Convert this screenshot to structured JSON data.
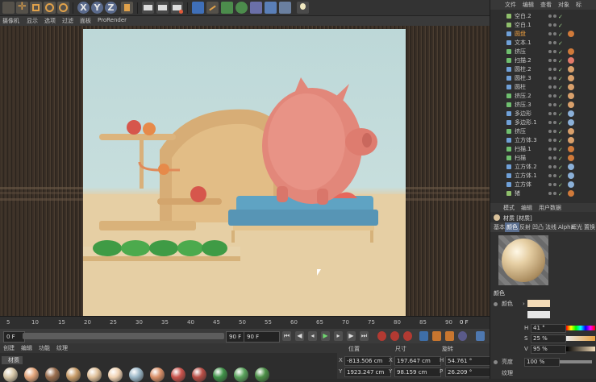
{
  "toolbar": {
    "axis_labels": [
      "X",
      "Y",
      "Z"
    ]
  },
  "viewport_menu": [
    "摄像机",
    "显示",
    "选项",
    "过滤",
    "面板",
    "ProRender"
  ],
  "timeline": {
    "ruler_ticks": [
      "5",
      "10",
      "15",
      "20",
      "25",
      "30",
      "35",
      "40",
      "45",
      "50",
      "55",
      "60",
      "65",
      "70",
      "75",
      "80",
      "85",
      "90"
    ],
    "current_frame_label": "0 F",
    "start_field": "0 F",
    "end_field": "90 F",
    "max_field": "90 F"
  },
  "material_menu": [
    "创建",
    "编辑",
    "功能",
    "纹理"
  ],
  "material_tab_label": "材质",
  "materials": [
    {
      "color": "#d7c7a8"
    },
    {
      "color": "#e3a57b"
    },
    {
      "color": "#9b6f4f"
    },
    {
      "color": "#c99d6a"
    },
    {
      "color": "#e0c09a"
    },
    {
      "color": "#f0d2b2"
    },
    {
      "color": "#9bb7c7"
    },
    {
      "color": "#d98f68"
    },
    {
      "color": "#c9524b"
    },
    {
      "color": "#b84d45"
    },
    {
      "color": "#3f9248"
    },
    {
      "color": "#5aa35c"
    },
    {
      "color": "#4b8f46"
    }
  ],
  "coordinates": {
    "headers": {
      "position": "位置",
      "size": "尺寸",
      "rotation": "旋转"
    },
    "rows": [
      {
        "axis": "X",
        "position": "-813.506 cm",
        "size_axis": "X",
        "size": "197.647 cm",
        "rot_axis": "H",
        "rotation": "54.761 °"
      },
      {
        "axis": "Y",
        "position": "1923.247 cm",
        "size_axis": "Y",
        "size": "98.159 cm",
        "rot_axis": "P",
        "rotation": "26.209 °"
      }
    ]
  },
  "object_manager": {
    "menu": [
      "文件",
      "编辑",
      "查看",
      "对象",
      "标"
    ],
    "objects": [
      {
        "name": "空白.2",
        "icon_color": "#8fbf6b",
        "tags": []
      },
      {
        "name": "空白.1",
        "icon_color": "#8fbf6b",
        "tags": []
      },
      {
        "name": "圆盘",
        "icon_color": "#6fa0d8",
        "tags": [
          "#d07a3a"
        ],
        "highlight": true
      },
      {
        "name": "文本.1",
        "icon_color": "#6fa0d8",
        "tags": []
      },
      {
        "name": "挤压",
        "icon_color": "#6fbf6f",
        "tags": [
          "#d07a3a"
        ]
      },
      {
        "name": "扫描.2",
        "icon_color": "#6fbf6f",
        "tags": [
          "#e27a6a"
        ]
      },
      {
        "name": "圆柱.2",
        "icon_color": "#6fa0d8",
        "tags": [
          "#d9a06b"
        ]
      },
      {
        "name": "圆柱.3",
        "icon_color": "#6fa0d8",
        "tags": [
          "#d9a06b"
        ]
      },
      {
        "name": "圆柱",
        "icon_color": "#6fa0d8",
        "tags": [
          "#d9a06b"
        ]
      },
      {
        "name": "挤压.2",
        "icon_color": "#6fbf6f",
        "tags": [
          "#d9a06b"
        ]
      },
      {
        "name": "挤压.3",
        "icon_color": "#6fbf6f",
        "tags": [
          "#d9a06b"
        ]
      },
      {
        "name": "多边形",
        "icon_color": "#6fa0d8",
        "tags": [
          "#8bb0d8"
        ]
      },
      {
        "name": "多边形.1",
        "icon_color": "#6fa0d8",
        "tags": [
          "#8bb0d8"
        ]
      },
      {
        "name": "挤压",
        "icon_color": "#6fbf6f",
        "tags": [
          "#d9a06b"
        ]
      },
      {
        "name": "立方体.3",
        "icon_color": "#6fa0d8",
        "tags": [
          "#d9a06b"
        ]
      },
      {
        "name": "扫描.1",
        "icon_color": "#6fbf6f",
        "tags": [
          "#d07a3a"
        ]
      },
      {
        "name": "扫描",
        "icon_color": "#6fbf6f",
        "tags": [
          "#d07a3a"
        ]
      },
      {
        "name": "立方体.2",
        "icon_color": "#6fa0d8",
        "tags": [
          "#8bb0d8"
        ]
      },
      {
        "name": "立方体.1",
        "icon_color": "#6fa0d8",
        "tags": [
          "#8bb0d8"
        ]
      },
      {
        "name": "立方体",
        "icon_color": "#6fa0d8",
        "tags": [
          "#8bb0d8"
        ]
      },
      {
        "name": "猪",
        "icon_color": "#8fbf6b",
        "tags": [
          "#d07a3a"
        ]
      }
    ]
  },
  "attribute_manager": {
    "menu": [
      "模式",
      "编辑",
      "用户数据"
    ],
    "title": "材质 [材质]",
    "tabs": [
      "基本",
      "颜色",
      "反射",
      "凹凸",
      "法线",
      "Alpha",
      "辉光",
      "置换"
    ],
    "active_tab_index": 1,
    "section_label": "颜色",
    "color_label": "颜色",
    "hsv": [
      {
        "label": "H",
        "value": "41 °"
      },
      {
        "label": "S",
        "value": "25 %"
      },
      {
        "label": "V",
        "value": "95 %"
      }
    ],
    "brightness_value": "100 %",
    "brightness_label": "亮度",
    "texture_label": "纹理",
    "swatch_color": "#f4dcb8"
  }
}
